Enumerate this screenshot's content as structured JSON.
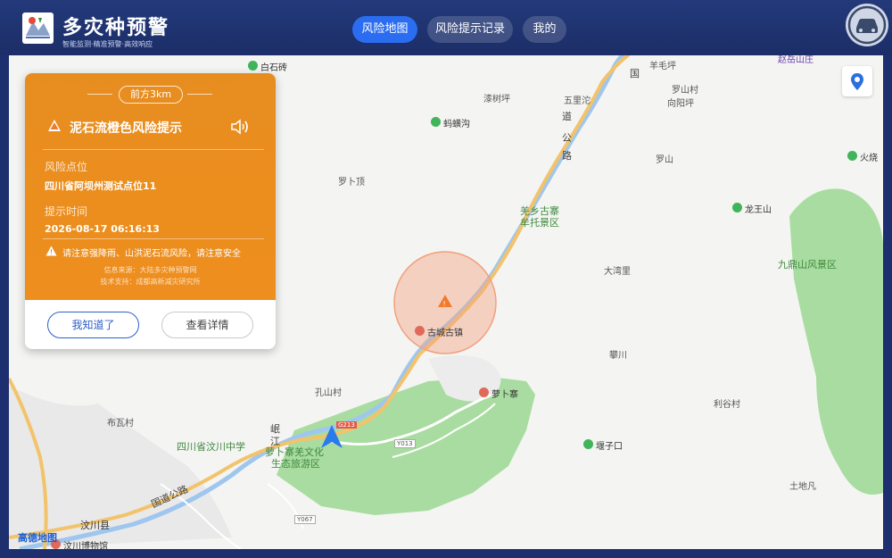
{
  "header": {
    "app_title": "多灾种预警",
    "app_subtitle": "智能监测·精准预警·高效响应",
    "tabs": [
      {
        "label": "风险地图",
        "active": true
      },
      {
        "label": "风险提示记录",
        "active": false
      },
      {
        "label": "我的",
        "active": false
      }
    ],
    "car_icon": "car-icon"
  },
  "alert": {
    "distance": "前方3km",
    "title": "泥石流橙色风险提示",
    "location_label": "风险点位",
    "location_value": "四川省阿坝州测试点位11",
    "time_label": "提示时间",
    "time_value": "2026-08-17 06:16:13",
    "notice": "请注意强降雨、山洪泥石流风险，请注意安全",
    "source": "信息来源：大陆多灾种预警网",
    "support": "技术支持：成都高新减灾研究所",
    "ack_button": "我知道了",
    "detail_button": "查看详情",
    "color": "#ee8e1e"
  },
  "map": {
    "place_labels": [
      "羊毛坪",
      "漆树坪",
      "五里沱",
      "罗山村",
      "向阳坪",
      "罗卜顶",
      "罗山",
      "大湾里",
      "攀川",
      "孔山村",
      "利谷村",
      "布瓦村",
      "土地凡",
      "汶川县"
    ],
    "pois": [
      "白石砖",
      "蚂蟥沟",
      "龙王山",
      "火烧",
      "古城古镇",
      "萝卜寨",
      "堰子口",
      "汶川博物馆",
      "赵岳山庄"
    ],
    "scenic_labels": [
      "羌乡古寨",
      "牟托景区",
      "九鼎山风景区",
      "四川省汶川中学",
      "萝卜寨羌文化",
      "生态旅游区"
    ],
    "road_labels": [
      "国",
      "道",
      "公",
      "路",
      "岷",
      "江",
      "国道公路"
    ],
    "road_badges": [
      "G213",
      "Y013",
      "Y067"
    ],
    "provider": "高德地图"
  }
}
